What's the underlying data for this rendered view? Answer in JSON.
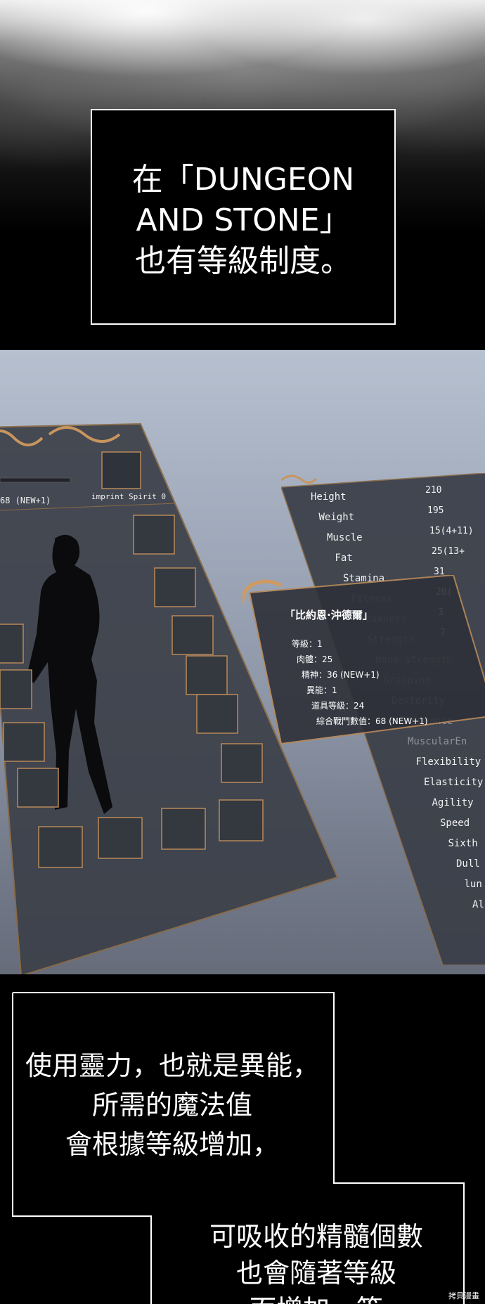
{
  "narration_1": "在「DUNGEON\nAND STONE」\n也有等級制度。",
  "equipment": {
    "value_left": "68 (NEW+1)",
    "imprint": "imprint Spirit 0"
  },
  "stats": {
    "labels": [
      "Height",
      "Weight",
      "Muscle",
      "Fat",
      "Stamina",
      "Fitness",
      "Weakness",
      "Strength",
      "Bone strength",
      "Grasping",
      "Dexterity",
      "Endurance",
      "MuscularEn",
      "Flexibility",
      "Elasticity",
      "Agility",
      "Speed",
      "Sixth",
      "Dull",
      "lun",
      "Al"
    ],
    "values": [
      "210",
      "195",
      "15(4+11)",
      "25(13+",
      "31",
      "20(",
      "3",
      "7"
    ]
  },
  "popup": {
    "title": "「比約恩·沖德爾」",
    "lines": [
      "等級：1",
      "肉體：25",
      "精神：36 (NEW+1)",
      "異能：1",
      "道具等級：24",
      "綜合戰鬥數值：68 (NEW+1)"
    ]
  },
  "narration_2": "使用靈力，也就是異能，\n所需的魔法值\n會根據等級增加，",
  "narration_3": "可吸收的精髓個數\n也會隨著等級\n而增加。等",
  "watermark": "拷貝漫畫",
  "colors": {
    "frame_gold": "#b8895a",
    "panel_dark": "#3a3e47"
  }
}
